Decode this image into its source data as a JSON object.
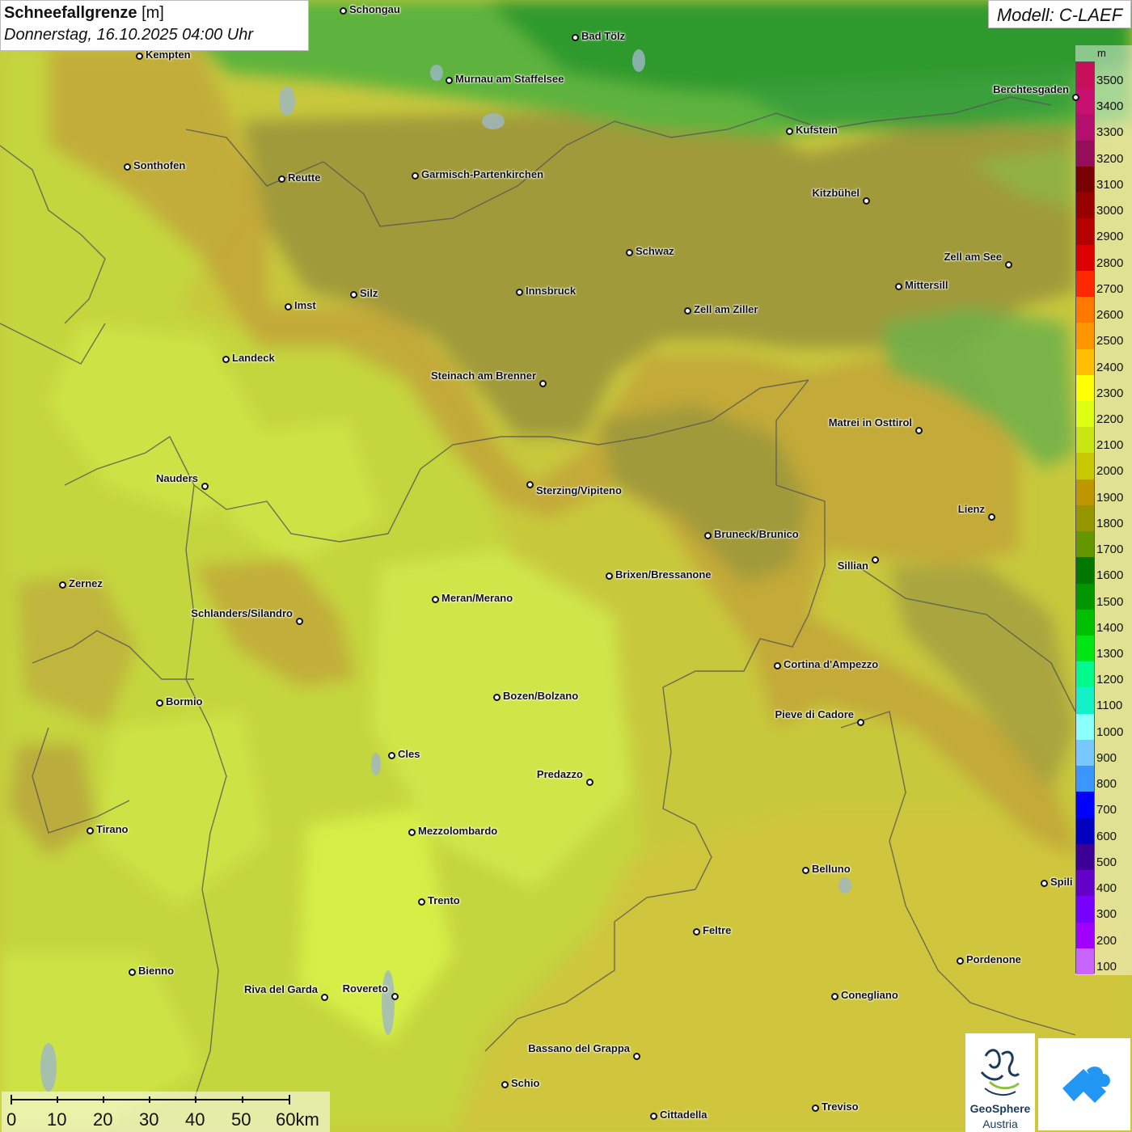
{
  "header": {
    "title": "Schneefallgrenze",
    "unit": "[m]",
    "datetime": "Donnerstag, 16.10.2025 04:00 Uhr"
  },
  "model_label": "Modell: C-LAEF",
  "legend": {
    "unit": "m",
    "entries": [
      {
        "value": "3500",
        "color": "#c8105a"
      },
      {
        "value": "3400",
        "color": "#c81070"
      },
      {
        "value": "3300",
        "color": "#b40e6e"
      },
      {
        "value": "3200",
        "color": "#960e5a"
      },
      {
        "value": "3100",
        "color": "#780000"
      },
      {
        "value": "3000",
        "color": "#960000"
      },
      {
        "value": "2900",
        "color": "#b40000"
      },
      {
        "value": "2800",
        "color": "#dc0000"
      },
      {
        "value": "2700",
        "color": "#ff2800"
      },
      {
        "value": "2600",
        "color": "#ff7800"
      },
      {
        "value": "2500",
        "color": "#ff9600"
      },
      {
        "value": "2400",
        "color": "#ffbe00"
      },
      {
        "value": "2300",
        "color": "#ffff00"
      },
      {
        "value": "2200",
        "color": "#dcff14"
      },
      {
        "value": "2100",
        "color": "#c8e614"
      },
      {
        "value": "2000",
        "color": "#c8c800"
      },
      {
        "value": "1900",
        "color": "#be9600"
      },
      {
        "value": "1800",
        "color": "#969600"
      },
      {
        "value": "1700",
        "color": "#649600"
      },
      {
        "value": "1600",
        "color": "#007800"
      },
      {
        "value": "1500",
        "color": "#009600"
      },
      {
        "value": "1400",
        "color": "#00be00"
      },
      {
        "value": "1300",
        "color": "#00e614"
      },
      {
        "value": "1200",
        "color": "#00fa8c"
      },
      {
        "value": "1100",
        "color": "#14f0c8"
      },
      {
        "value": "1000",
        "color": "#8cffff"
      },
      {
        "value": "900",
        "color": "#78c8ff"
      },
      {
        "value": "800",
        "color": "#3c96ff"
      },
      {
        "value": "700",
        "color": "#0000ff"
      },
      {
        "value": "600",
        "color": "#0000be"
      },
      {
        "value": "500",
        "color": "#3c0096"
      },
      {
        "value": "400",
        "color": "#6400c8"
      },
      {
        "value": "300",
        "color": "#7800ff"
      },
      {
        "value": "200",
        "color": "#a000ff"
      },
      {
        "value": "100",
        "color": "#c864ff"
      }
    ]
  },
  "cities": [
    {
      "name": "Schongau"
    },
    {
      "name": "Bad Tölz"
    },
    {
      "name": "Kempten"
    },
    {
      "name": "Murnau am Staffelsee"
    },
    {
      "name": "Berchtesgaden"
    },
    {
      "name": "Kufstein"
    },
    {
      "name": "Sonthofen"
    },
    {
      "name": "Reutte"
    },
    {
      "name": "Garmisch-Partenkirchen"
    },
    {
      "name": "Kitzbühel"
    },
    {
      "name": "Schwaz"
    },
    {
      "name": "Zell am See"
    },
    {
      "name": "Mittersill"
    },
    {
      "name": "Innsbruck"
    },
    {
      "name": "Imst"
    },
    {
      "name": "Silz"
    },
    {
      "name": "Zell am Ziller"
    },
    {
      "name": "Landeck"
    },
    {
      "name": "Steinach am Brenner"
    },
    {
      "name": "Matrei in Osttirol"
    },
    {
      "name": "Nauders"
    },
    {
      "name": "Sterzing/Vipiteno"
    },
    {
      "name": "Lienz"
    },
    {
      "name": "Bruneck/Brunico"
    },
    {
      "name": "Sillian"
    },
    {
      "name": "Zernez"
    },
    {
      "name": "Brixen/Bressanone"
    },
    {
      "name": "Meran/Merano"
    },
    {
      "name": "Schlanders/Silandro"
    },
    {
      "name": "Cortina d'Ampezzo"
    },
    {
      "name": "Bormio"
    },
    {
      "name": "Bozen/Bolzano"
    },
    {
      "name": "Pieve di Cadore"
    },
    {
      "name": "Cles"
    },
    {
      "name": "Predazzo"
    },
    {
      "name": "Tirano"
    },
    {
      "name": "Mezzolombardo"
    },
    {
      "name": "Belluno"
    },
    {
      "name": "Spili"
    },
    {
      "name": "Trento"
    },
    {
      "name": "Feltre"
    },
    {
      "name": "Pordenone"
    },
    {
      "name": "Bienno"
    },
    {
      "name": "Riva del Garda"
    },
    {
      "name": "Rovereto"
    },
    {
      "name": "Conegliano"
    },
    {
      "name": "Bassano del Grappa"
    },
    {
      "name": "Schio"
    },
    {
      "name": "Treviso"
    },
    {
      "name": "Cittadella"
    }
  ],
  "scale": {
    "ticks": [
      "0",
      "10",
      "20",
      "30",
      "40",
      "50",
      "60km"
    ]
  },
  "logo": {
    "line1": "GeoSphere",
    "line2": "Austria"
  }
}
